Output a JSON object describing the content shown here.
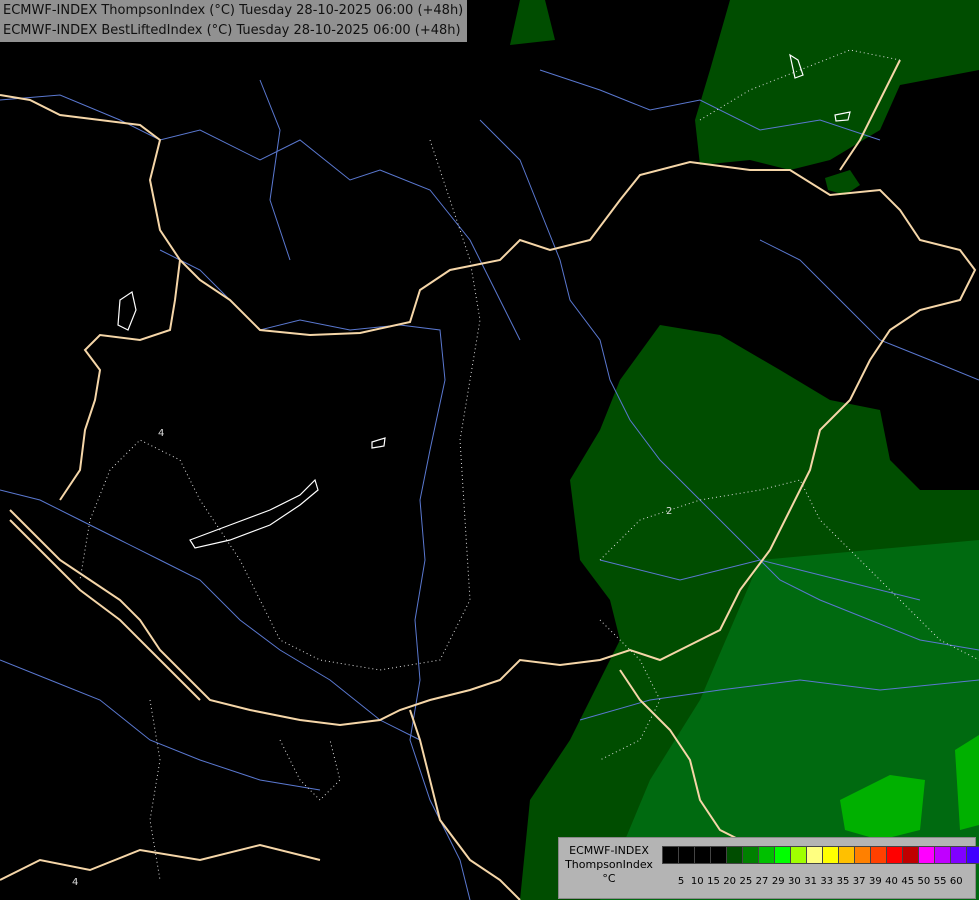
{
  "header": {
    "line1": "ECMWF-INDEX ThompsonIndex (°C) Tuesday 28-10-2025 06:00 (+48h)",
    "line2": "ECMWF-INDEX BestLiftedIndex (°C) Tuesday 28-10-2025 06:00 (+48h)"
  },
  "legend": {
    "title_model": "ECMWF-INDEX",
    "title_param": "ThompsonIndex",
    "title_unit": "°C",
    "colors": [
      "#000000",
      "#000000",
      "#000000",
      "#000000",
      "#004d00",
      "#008000",
      "#00c000",
      "#00ff00",
      "#a0ff00",
      "#ffff80",
      "#ffff00",
      "#ffc000",
      "#ff8000",
      "#ff4000",
      "#ff0000",
      "#c00000",
      "#ff00ff",
      "#c000ff",
      "#8000ff",
      "#4000ff",
      "#0000ff"
    ],
    "ticks": [
      "5",
      "10",
      "15",
      "20",
      "25",
      "27",
      "29",
      "30",
      "31",
      "33",
      "35",
      "37",
      "39",
      "40",
      "45",
      "50",
      "55",
      "60"
    ]
  },
  "contour_labels": [
    "4",
    "2",
    "4"
  ],
  "map_colors": {
    "background": "#000000",
    "dark_green": "#004d00",
    "mid_green": "#006a10",
    "bright_green": "#00b000",
    "borders": "#f5d6a8",
    "rivers": "#5a78d0",
    "lakes": "#ffffff"
  }
}
